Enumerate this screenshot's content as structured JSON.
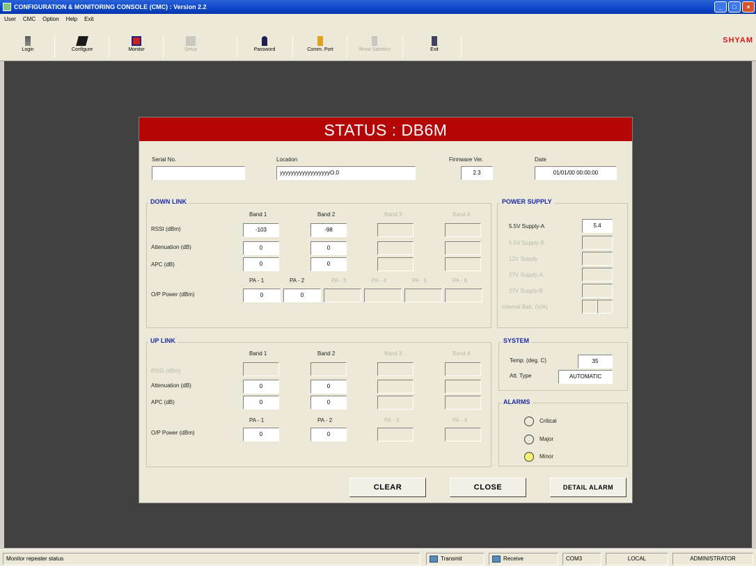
{
  "window": {
    "title": "CONFIGURATION & MONITORING CONSOLE (CMC) :  Version 2.2"
  },
  "menu": [
    "User",
    "CMC",
    "Option",
    "Help",
    "Exit"
  ],
  "toolbar": [
    {
      "label": "Login",
      "icon": "login-icon",
      "disabled": false
    },
    {
      "label": "Configure",
      "icon": "configure-icon",
      "disabled": false
    },
    {
      "label": "Monitor",
      "icon": "monitor-icon",
      "disabled": false
    },
    {
      "label": "Setup",
      "icon": "setup-icon",
      "disabled": true
    },
    {
      "label": "Password",
      "icon": "password-icon",
      "disabled": false
    },
    {
      "label": "Comm. Port",
      "icon": "comm-port-icon",
      "disabled": false
    },
    {
      "label": "Show Satistics",
      "icon": "statistics-icon",
      "disabled": true
    },
    {
      "label": "Exit",
      "icon": "exit-icon",
      "disabled": false
    }
  ],
  "brand": "SHYAM",
  "dialog": {
    "title": "STATUS : DB6M",
    "info": {
      "serial_label": "Serial No.",
      "serial_value": "",
      "location_label": "Location",
      "location_value": "yyyyyyyyyyyyyyyyyyO.0",
      "firmware_label": "Firmware Ver.",
      "firmware_value": "2.3",
      "date_label": "Date",
      "date_value": "01/01/00 00:00:00"
    },
    "downlink": {
      "title": "DOWN LINK",
      "bands": [
        "Band 1",
        "Band 2",
        "Band 3",
        "Band 4"
      ],
      "rssi_label": "RSSI (dBm)",
      "rssi": [
        "-103",
        "-98"
      ],
      "atten_label": "Attenuation (dB)",
      "atten": [
        "0",
        "0"
      ],
      "apc_label": "APC (dB)",
      "apc": [
        "0",
        "0"
      ],
      "pa_labels": [
        "PA - 1",
        "PA - 2",
        "PA - 3",
        "PA - 4",
        "PA - 5",
        "PA - 6"
      ],
      "op_label": "O/P Power (dBm)",
      "op": [
        "0",
        "0"
      ]
    },
    "uplink": {
      "title": "UP LINK",
      "bands": [
        "Band 1",
        "Band 2",
        "Band 3",
        "Band 4"
      ],
      "rssi_label": "RSSI (dBm)",
      "atten_label": "Attenuation (dB)",
      "atten": [
        "0",
        "0"
      ],
      "apc_label": "APC (dB)",
      "apc": [
        "0",
        "0"
      ],
      "pa_labels": [
        "PA - 1",
        "PA - 2",
        "PA - 3",
        "PA - 4"
      ],
      "op_label": "O/P Power (dBm)",
      "op": [
        "0",
        "0"
      ]
    },
    "power_supply": {
      "title": "POWER SUPPLY",
      "items": [
        "5.5V Supply-A",
        "5.5V Supply-B",
        "12V Supply",
        "27V Supply-A",
        "27V Supply-B",
        "Internal Batt. (V/A)"
      ],
      "supply_a_value": "5.4"
    },
    "system": {
      "title": "SYSTEM",
      "temp_label": "Temp. (deg. C)",
      "temp_value": "35",
      "att_label": "Att. Type",
      "att_value": "AUTOMATIC"
    },
    "alarms": {
      "title": "ALARMS",
      "items": [
        "Critical",
        "Major",
        "Minor"
      ],
      "active_color": "#f4f070"
    },
    "buttons": {
      "clear": "CLEAR",
      "close": "CLOSE",
      "detail": "DETAIL ALARM"
    }
  },
  "status_bar": {
    "message": "Monitor repeater status",
    "transmit": "Transmit",
    "receive": "Receive",
    "com": "COM3",
    "mode": "LOCAL",
    "user": "ADMINISTRATOR"
  }
}
